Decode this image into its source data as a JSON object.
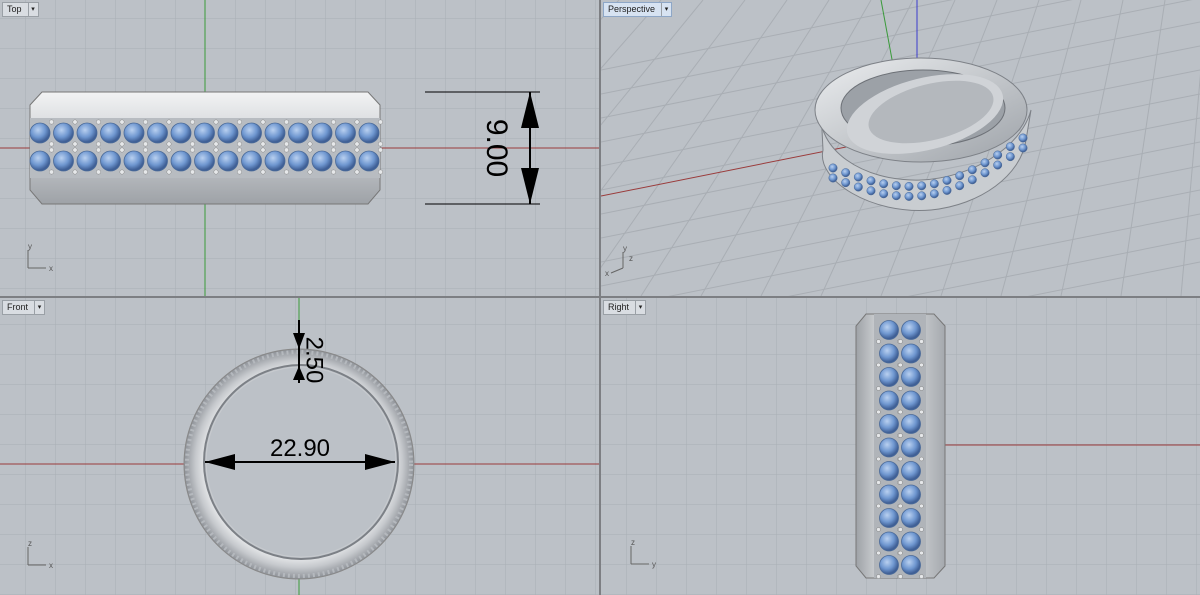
{
  "viewports": [
    {
      "name": "Top",
      "dropdown_icon": "chevron-down-icon",
      "axis": {
        "v": "y",
        "h": "x"
      },
      "dimension": "9.00"
    },
    {
      "name": "Perspective",
      "dropdown_icon": "chevron-down-icon",
      "axis": {
        "v": "y",
        "h": "z",
        "extra": "x"
      }
    },
    {
      "name": "Front",
      "dropdown_icon": "chevron-down-icon",
      "axis": {
        "v": "z",
        "h": "x"
      },
      "dimensions": {
        "thickness": "2.50",
        "inner_diameter": "22.90"
      }
    },
    {
      "name": "Right",
      "dropdown_icon": "chevron-down-icon",
      "axis": {
        "v": "z",
        "h": "y"
      }
    }
  ],
  "colors": {
    "viewport_bg": "#bcc1c7",
    "grid_minor": "#a9aeb4",
    "grid_major": "#979ca2",
    "x_axis": "#b23a3a",
    "y_axis": "#3a9a3a",
    "z_axis": "#3a3acc",
    "metal": "#d4d6d9",
    "gem": "#6f97d0"
  }
}
